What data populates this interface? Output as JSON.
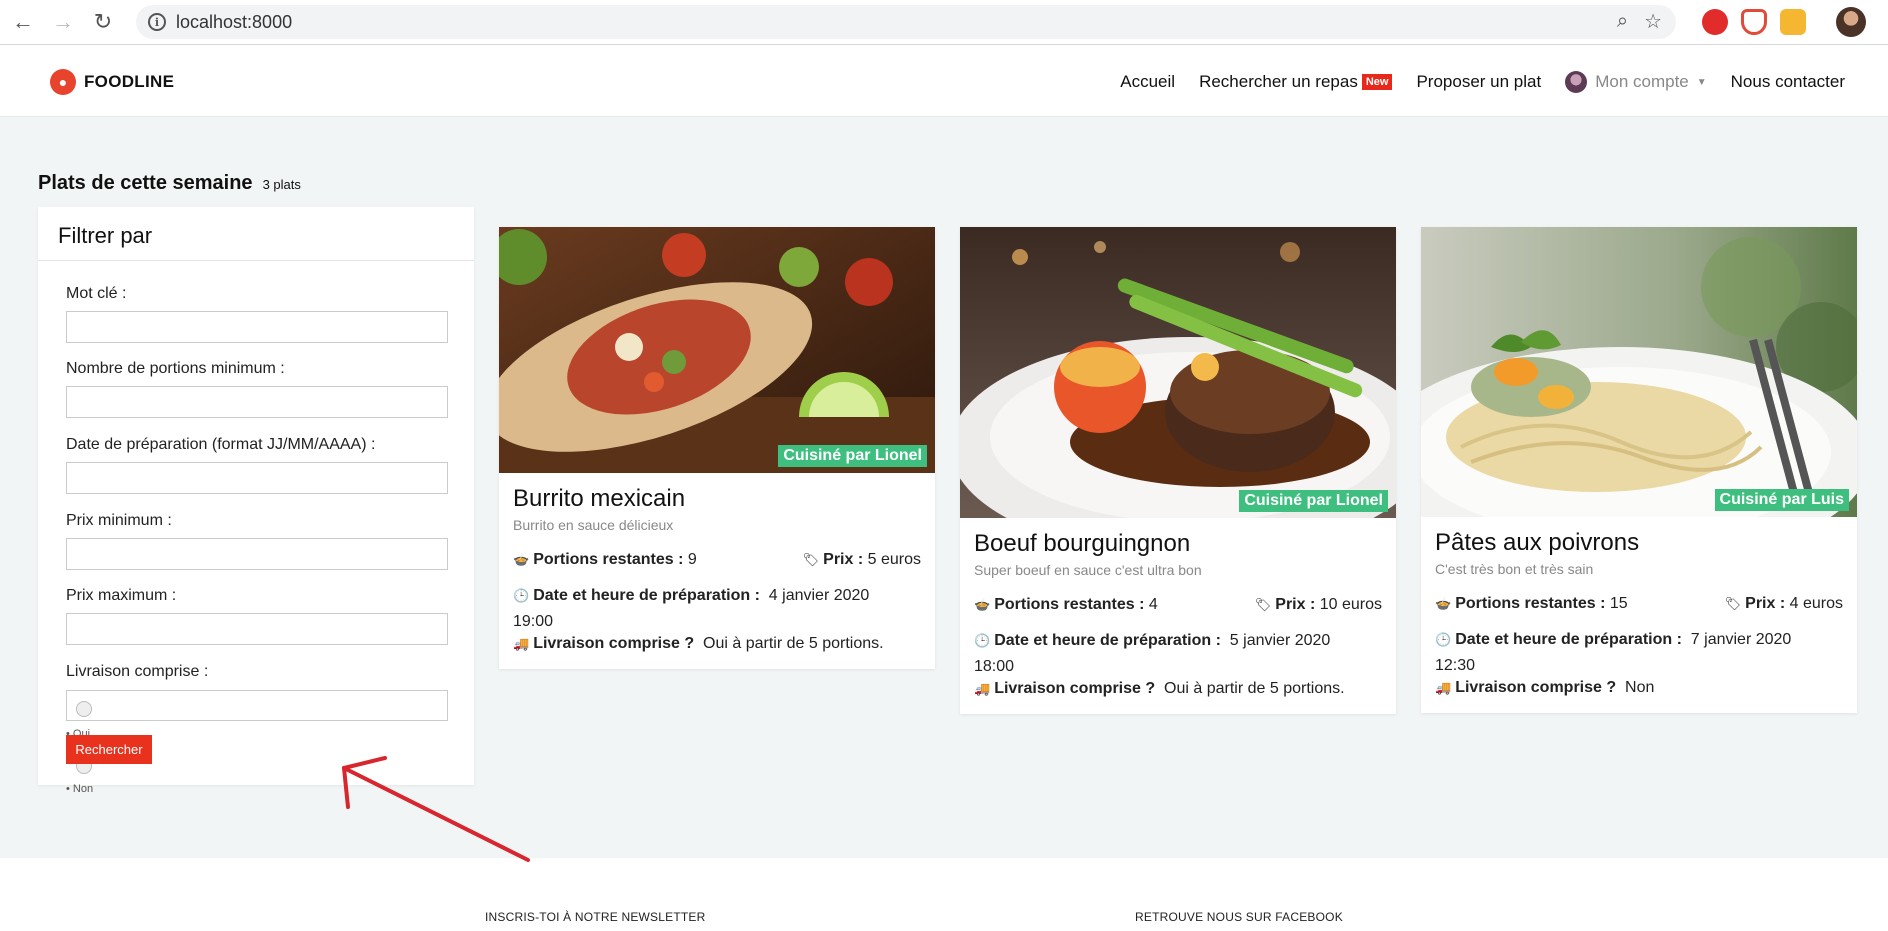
{
  "browser": {
    "url": "localhost:8000"
  },
  "header": {
    "brand": "FOODLINE",
    "menu": {
      "home": "Accueil",
      "search": "Rechercher un repas",
      "search_badge": "New",
      "propose": "Proposer un plat",
      "account": "Mon compte",
      "contact": "Nous contacter"
    }
  },
  "section": {
    "title": "Plats de cette semaine",
    "count": "3 plats"
  },
  "filter": {
    "title": "Filtrer par",
    "fields": [
      {
        "label": "Mot clé :"
      },
      {
        "label": "Nombre de portions minimum :"
      },
      {
        "label": "Date de préparation (format JJ/MM/AAAA) :"
      },
      {
        "label": "Prix minimum :"
      },
      {
        "label": "Prix maximum :"
      },
      {
        "label": "Livraison comprise :"
      }
    ],
    "radio_yes": "Oui",
    "radio_no": "Non",
    "submit": "Rechercher"
  },
  "dishes": [
    {
      "title": "Burrito mexicain",
      "subtitle": "Burrito en sauce délicieux",
      "chef": "Cuisiné par Lionel",
      "portions_label": "Portions restantes :",
      "portions": "9",
      "price_label": "Prix :",
      "price": "5 euros",
      "date_label": "Date et heure de préparation :",
      "date": "4 janvier 2020",
      "time": "19:00",
      "delivery_label": "Livraison comprise ?",
      "delivery": "Oui à partir de 5 portions."
    },
    {
      "title": "Boeuf bourguingnon",
      "subtitle": "Super boeuf en sauce c'est ultra bon",
      "chef": "Cuisiné par Lionel",
      "portions_label": "Portions restantes :",
      "portions": "4",
      "price_label": "Prix :",
      "price": "10 euros",
      "date_label": "Date et heure de préparation :",
      "date": "5 janvier 2020",
      "time": "18:00",
      "delivery_label": "Livraison comprise ?",
      "delivery": "Oui à partir de 5 portions."
    },
    {
      "title": "Pâtes aux poivrons",
      "subtitle": "C'est très bon et très sain",
      "chef": "Cuisiné par Luis",
      "portions_label": "Portions restantes :",
      "portions": "15",
      "price_label": "Prix :",
      "price": "4 euros",
      "date_label": "Date et heure de préparation :",
      "date": "7 janvier 2020",
      "time": "12:30",
      "delivery_label": "Livraison comprise ?",
      "delivery": "Non"
    }
  ],
  "footer": {
    "newsletter": "INSCRIS-TOI À NOTRE NEWSLETTER",
    "facebook": "RETROUVE NOUS SUR FACEBOOK"
  },
  "colors": {
    "accent": "#e8321e",
    "chef_tag": "#3fbf7f",
    "annotation": "#d8262e"
  }
}
